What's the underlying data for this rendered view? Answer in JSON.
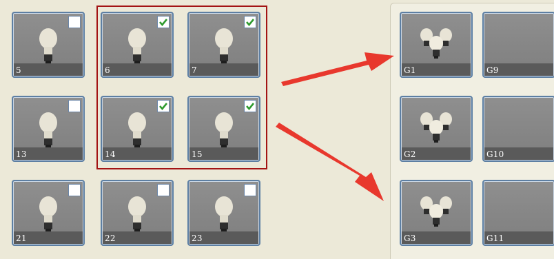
{
  "lights": [
    {
      "label": "5",
      "checked": false
    },
    {
      "label": "6",
      "checked": true
    },
    {
      "label": "7",
      "checked": true
    },
    {
      "label": "13",
      "checked": false
    },
    {
      "label": "14",
      "checked": true
    },
    {
      "label": "15",
      "checked": true
    },
    {
      "label": "21",
      "checked": false
    },
    {
      "label": "22",
      "checked": false
    },
    {
      "label": "23",
      "checked": false
    }
  ],
  "groups": [
    {
      "label": "G1",
      "has_icon": true
    },
    {
      "label": "G9",
      "has_icon": false
    },
    {
      "label": "G2",
      "has_icon": true
    },
    {
      "label": "G10",
      "has_icon": false
    },
    {
      "label": "G3",
      "has_icon": true
    },
    {
      "label": "G11",
      "has_icon": false
    }
  ],
  "icons": {
    "light": "bulb-icon",
    "group": "bulb-group-icon",
    "checkbox_checked": "checkmark-icon"
  },
  "colors": {
    "selection_border": "#a31414",
    "arrow": "#e8382d",
    "tile_border": "#5d7fa3",
    "check_green": "#2e9a2e"
  }
}
